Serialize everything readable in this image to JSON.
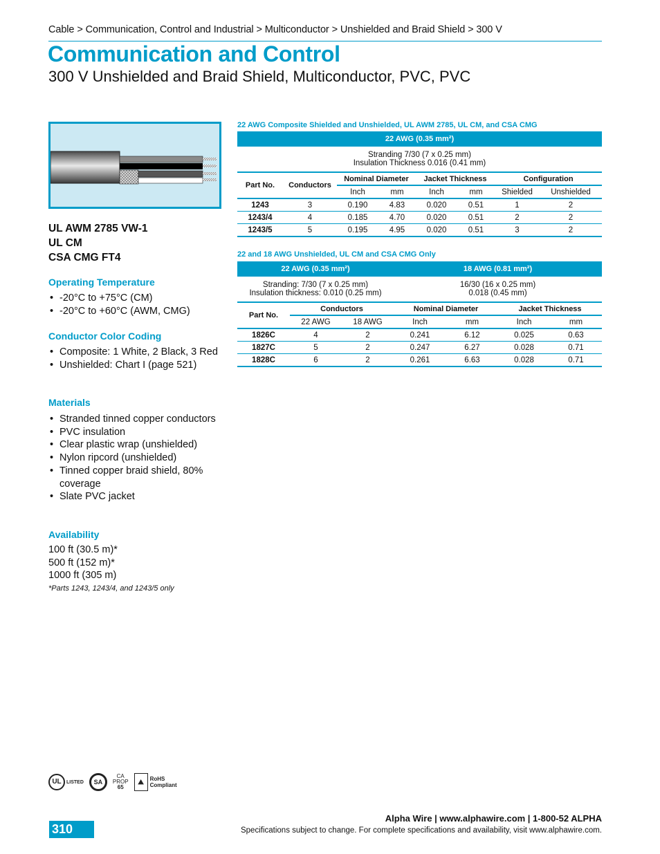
{
  "breadcrumb": "Cable > Communication, Control and Industrial > Multiconductor > Unshielded and Braid Shield > 300 V",
  "title": "Communication and Control",
  "subtitle": "300 V Unshielded and Braid Shield, Multiconductor, PVC, PVC",
  "image": {
    "alt": "cable-cutaway-illustration",
    "bg_color": "#cce9f3",
    "border_color": "#009cc9"
  },
  "ratings": [
    "UL AWM 2785 VW-1",
    "UL CM",
    "CSA CMG FT4"
  ],
  "sections": {
    "operating_temperature": {
      "heading": "Operating Temperature",
      "items": [
        "-20°C to +75°C (CM)",
        "-20°C to +60°C (AWM, CMG)"
      ]
    },
    "color_coding": {
      "heading": "Conductor Color Coding",
      "items": [
        "Composite: 1 White, 2 Black, 3 Red",
        "Unshielded: Chart I (page 521)"
      ]
    },
    "materials": {
      "heading": "Materials",
      "items": [
        "Stranded tinned copper conductors",
        "PVC insulation",
        "Clear plastic wrap (unshielded)",
        "Nylon ripcord (unshielded)",
        "Tinned copper braid shield, 80% coverage",
        "Slate PVC jacket"
      ]
    },
    "availability": {
      "heading": "Availability",
      "items": [
        "100 ft (30.5 m)*",
        "500 ft (152 m)*",
        "1000 ft (305 m)"
      ],
      "note": "*Parts 1243, 1243/4, and 1243/5 only"
    }
  },
  "table1": {
    "caption": "22 AWG Composite Shielded and Unshielded, UL AWM 2785, UL CM, and CSA CMG",
    "awg_bar": "22 AWG (0.35 mm²)",
    "stranding": "Stranding 7/30 (7 x 0.25 mm)",
    "insulation": "Insulation Thickness 0.016 (0.41 mm)",
    "headers": {
      "part_no": "Part No.",
      "conductors": "Conductors",
      "nominal_diameter": "Nominal Diameter",
      "jacket_thickness": "Jacket Thickness",
      "configuration": "Configuration",
      "inch": "Inch",
      "mm": "mm",
      "shielded": "Shielded",
      "unshielded": "Unshielded"
    },
    "rows": [
      {
        "part": "1243",
        "conductors": "3",
        "nd_inch": "0.190",
        "nd_mm": "4.83",
        "jt_inch": "0.020",
        "jt_mm": "0.51",
        "shielded": "1",
        "unshielded": "2"
      },
      {
        "part": "1243/4",
        "conductors": "4",
        "nd_inch": "0.185",
        "nd_mm": "4.70",
        "jt_inch": "0.020",
        "jt_mm": "0.51",
        "shielded": "2",
        "unshielded": "2"
      },
      {
        "part": "1243/5",
        "conductors": "5",
        "nd_inch": "0.195",
        "nd_mm": "4.95",
        "jt_inch": "0.020",
        "jt_mm": "0.51",
        "shielded": "3",
        "unshielded": "2"
      }
    ]
  },
  "table2": {
    "caption": "22 and 18 AWG Unshielded, UL CM and CSA CMG Only",
    "awg_bar_22": "22 AWG (0.35 mm²)",
    "awg_bar_18": "18 AWG (0.81 mm²)",
    "stranding_22": "Stranding: 7/30 (7 x 0.25 mm)",
    "insulation_22": "Insulation thickness: 0.010 (0.25 mm)",
    "stranding_18": "16/30 (16 x 0.25 mm)",
    "insulation_18": "0.018 (0.45 mm)",
    "headers": {
      "part_no": "Part No.",
      "conductors": "Conductors",
      "nominal_diameter": "Nominal Diameter",
      "jacket_thickness": "Jacket Thickness",
      "awg22": "22 AWG",
      "awg18": "18 AWG",
      "inch": "Inch",
      "mm": "mm"
    },
    "rows": [
      {
        "part": "1826C",
        "c22": "4",
        "c18": "2",
        "nd_inch": "0.241",
        "nd_mm": "6.12",
        "jt_inch": "0.025",
        "jt_mm": "0.63"
      },
      {
        "part": "1827C",
        "c22": "5",
        "c18": "2",
        "nd_inch": "0.247",
        "nd_mm": "6.27",
        "jt_inch": "0.028",
        "jt_mm": "0.71"
      },
      {
        "part": "1828C",
        "c22": "6",
        "c18": "2",
        "nd_inch": "0.261",
        "nd_mm": "6.63",
        "jt_inch": "0.028",
        "jt_mm": "0.71"
      }
    ]
  },
  "logos": {
    "ul": "UL",
    "ul_listed": "LISTED",
    "csa": "SA",
    "prop65": [
      "CA",
      "PROP",
      "65"
    ],
    "rohs": [
      "RoHS",
      "Compliant"
    ]
  },
  "footer": {
    "page_number": "310",
    "contact": "Alpha Wire | www.alphawire.com | 1-800-52 ALPHA",
    "note": "Specifications subject to change. For complete specifications and availability, visit www.alphawire.com."
  },
  "colors": {
    "accent": "#009cc9",
    "text": "#111111"
  }
}
